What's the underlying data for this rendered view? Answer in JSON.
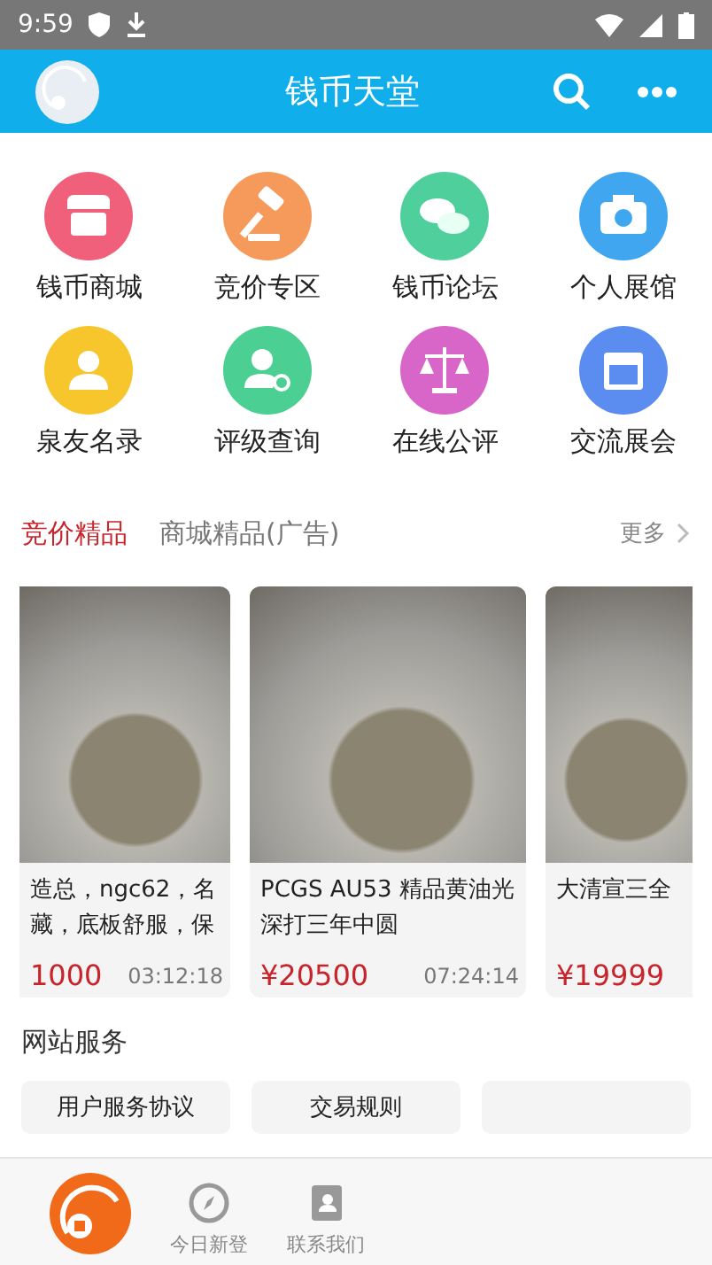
{
  "status_bar": {
    "time": "9:59"
  },
  "header": {
    "title": "钱币天堂"
  },
  "shortcuts": [
    {
      "label": "钱币商城",
      "kind": "shop",
      "color": "#f0607a"
    },
    {
      "label": "竞价专区",
      "kind": "gavel",
      "color": "#f59a5a"
    },
    {
      "label": "钱币论坛",
      "kind": "chat",
      "color": "#4fcf9c"
    },
    {
      "label": "个人展馆",
      "kind": "camera",
      "color": "#3fa6ef"
    },
    {
      "label": "泉友名录",
      "kind": "person",
      "color": "#f7c52c"
    },
    {
      "label": "评级查询",
      "kind": "search-person",
      "color": "#4ccf92"
    },
    {
      "label": "在线公评",
      "kind": "scales",
      "color": "#d866c8"
    },
    {
      "label": "交流展会",
      "kind": "calendar",
      "color": "#5b8df0"
    }
  ],
  "tabs": [
    {
      "label": "竞价精品",
      "selected": true
    },
    {
      "label": "商城精品(广告)",
      "selected": false
    }
  ],
  "more": "更多",
  "products": [
    {
      "title_lines": [
        "造总，ngc62，名",
        "藏，底板舒服，保"
      ],
      "price": "1000",
      "time": "03:12:18",
      "kind": "clipped-left"
    },
    {
      "title_lines": [
        "PCGS AU53 精品黄油光",
        "深打三年中圆"
      ],
      "price": "¥20500",
      "time": "07:24:14",
      "kind": "whole"
    },
    {
      "title_lines": [
        "大清宣三全"
      ],
      "price": "¥19999",
      "kind": "clipped-right"
    }
  ],
  "services_title": "网站服务",
  "services": [
    "用户服务协议",
    "交易规则"
  ],
  "nav": [
    {
      "label": "今日新登",
      "kind": "compass"
    },
    {
      "label": "联系我们",
      "kind": "contacts"
    }
  ]
}
